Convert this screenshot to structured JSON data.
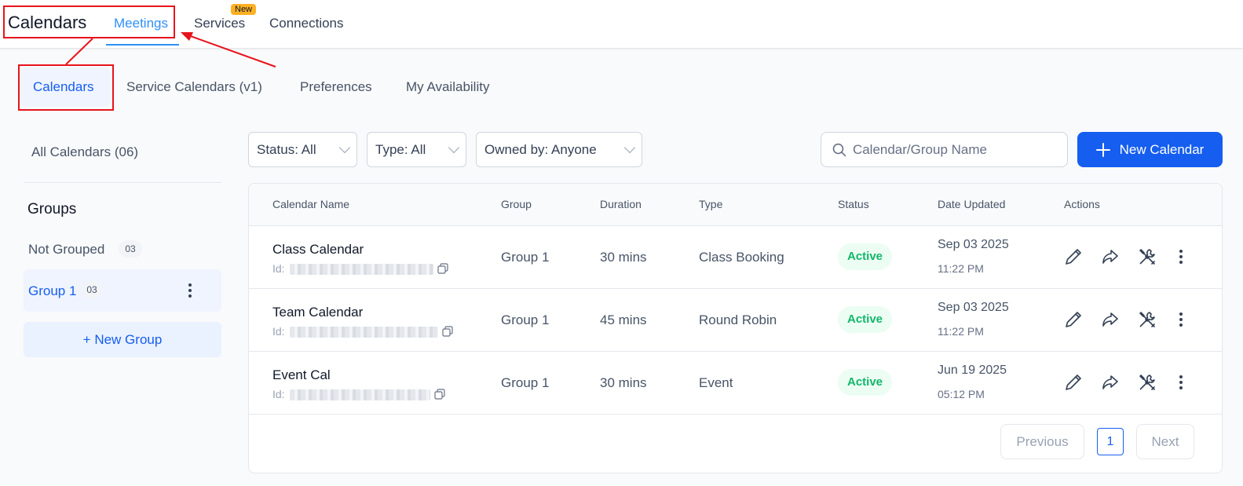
{
  "header": {
    "title": "Calendars",
    "tabs": [
      {
        "label": "Meetings",
        "active": true
      },
      {
        "label": "Services",
        "badge": "New"
      },
      {
        "label": "Connections"
      }
    ]
  },
  "subtabs": [
    {
      "label": "Calendars",
      "active": true
    },
    {
      "label": "Service Calendars (v1)"
    },
    {
      "label": "Preferences"
    },
    {
      "label": "My Availability"
    }
  ],
  "sidebar": {
    "all_calendars": "All Calendars (06)",
    "groups_heading": "Groups",
    "groups": [
      {
        "label": "Not Grouped",
        "count": "03"
      },
      {
        "label": "Group 1",
        "count": "03",
        "active": true
      }
    ],
    "new_group": "+ New Group"
  },
  "filters": {
    "status": "Status: All",
    "type": "Type: All",
    "owner": "Owned by: Anyone"
  },
  "search": {
    "placeholder": "Calendar/Group Name"
  },
  "new_calendar": "New Calendar",
  "table": {
    "columns": [
      "Calendar Name",
      "Group",
      "Duration",
      "Type",
      "Status",
      "Date Updated",
      "Actions"
    ],
    "rows": [
      {
        "name": "Class Calendar",
        "id_label": "Id:",
        "group": "Group 1",
        "duration": "30 mins",
        "type": "Class Booking",
        "status": "Active",
        "date": "Sep 03 2025",
        "time": "11:22 PM"
      },
      {
        "name": "Team Calendar",
        "id_label": "Id:",
        "group": "Group 1",
        "duration": "45 mins",
        "type": "Round Robin",
        "status": "Active",
        "date": "Sep 03 2025",
        "time": "11:22 PM"
      },
      {
        "name": "Event Cal",
        "id_label": "Id:",
        "group": "Group 1",
        "duration": "30 mins",
        "type": "Event",
        "status": "Active",
        "date": "Jun 19 2025",
        "time": "05:12 PM"
      }
    ]
  },
  "pagination": {
    "previous": "Previous",
    "page": "1",
    "next": "Next"
  },
  "colors": {
    "accent": "#155eef",
    "tab_active": "#2e90fa",
    "success": "#12b76a",
    "annotation": "#e8141c"
  }
}
